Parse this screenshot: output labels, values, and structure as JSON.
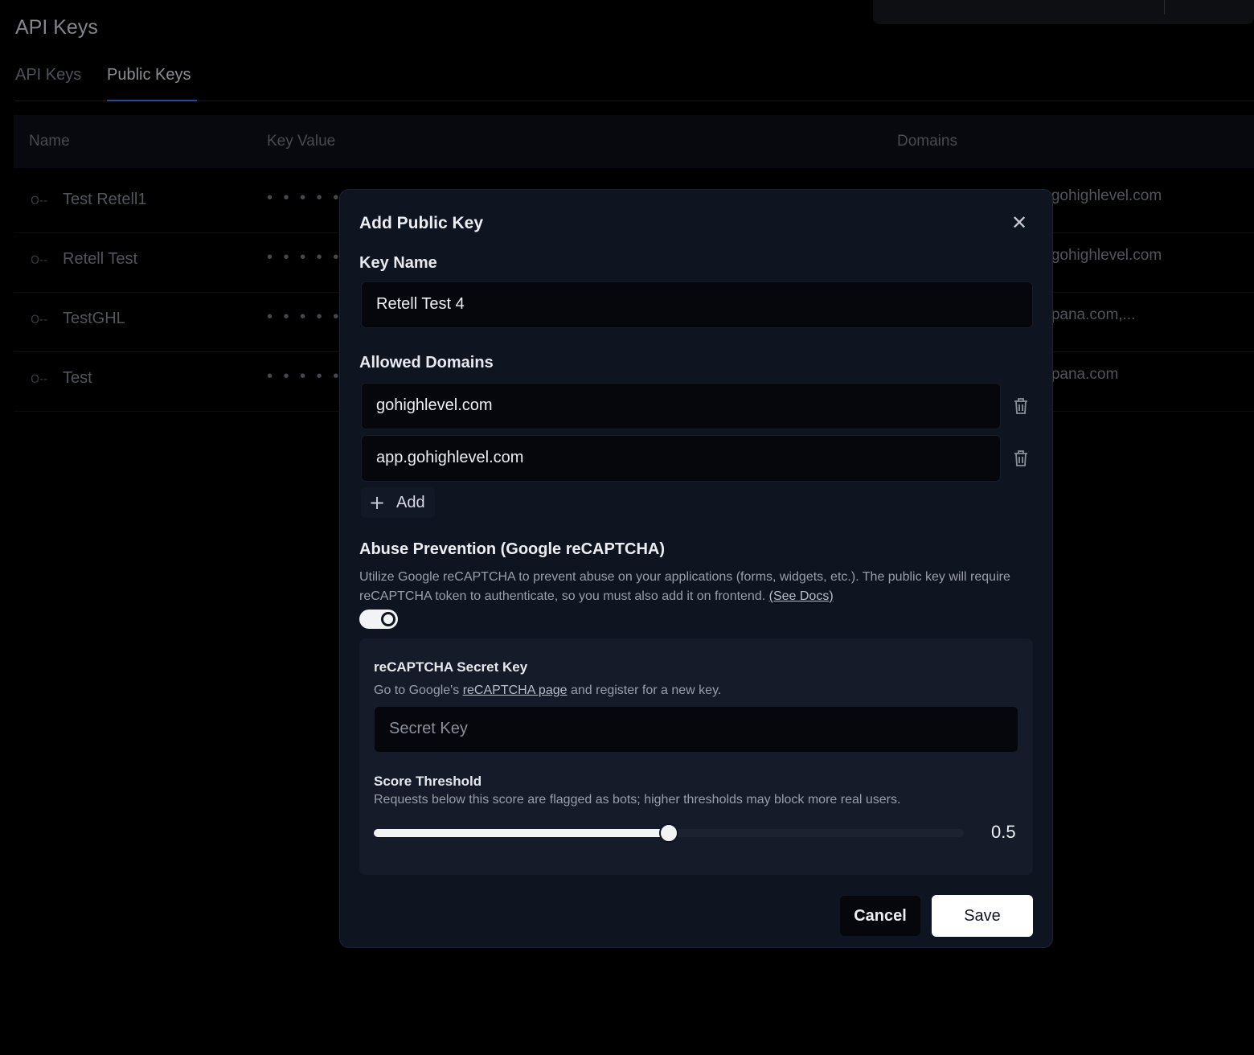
{
  "page": {
    "title": "API Keys"
  },
  "tabs": [
    {
      "label": "API Keys",
      "active": false
    },
    {
      "label": "Public Keys",
      "active": true
    }
  ],
  "table": {
    "columns": [
      "Name",
      "Key Value",
      "Domains"
    ],
    "rows": [
      {
        "name": "Test Retell1",
        "key_mask": "• • • • • •",
        "domains": "p.gohighlevel.com"
      },
      {
        "name": "Retell Test",
        "key_mask": "• • • • • •",
        "domains": "p.gohighlevel.com"
      },
      {
        "name": "TestGHL",
        "key_mask": "• • • • • •",
        "domains": "mpana.com,..."
      },
      {
        "name": "Test",
        "key_mask": "• • • • • •",
        "domains": "mpana.com"
      }
    ]
  },
  "modal": {
    "title": "Add Public Key",
    "key_name_label": "Key Name",
    "key_name_value": "Retell Test 4",
    "allowed_domains_label": "Allowed Domains",
    "domains": [
      "gohighlevel.com",
      "app.gohighlevel.com"
    ],
    "add_label": "Add",
    "abuse_title": "Abuse Prevention (Google reCAPTCHA)",
    "abuse_desc": "Utilize Google reCAPTCHA to prevent abuse on your applications (forms, widgets, etc.). The public key will require reCAPTCHA token to authenticate, so you must also add it on frontend.",
    "see_docs": "(See Docs)",
    "recaptcha_enabled": true,
    "secret_key_title": "reCAPTCHA Secret Key",
    "secret_key_desc_prefix": "Go to Google's",
    "secret_key_link": "reCAPTCHA page",
    "secret_key_desc_suffix": "and register for a new key.",
    "secret_key_placeholder": "Secret Key",
    "score_title": "Score Threshold",
    "score_desc": "Requests below this score are flagged as bots; higher thresholds may block more real users.",
    "score_value": "0.5",
    "score_fraction": 0.5,
    "cancel_label": "Cancel",
    "save_label": "Save"
  },
  "icons": {
    "row_icon": "key-icon",
    "close": "close-icon",
    "delete": "trash-icon",
    "add": "plus-icon"
  }
}
